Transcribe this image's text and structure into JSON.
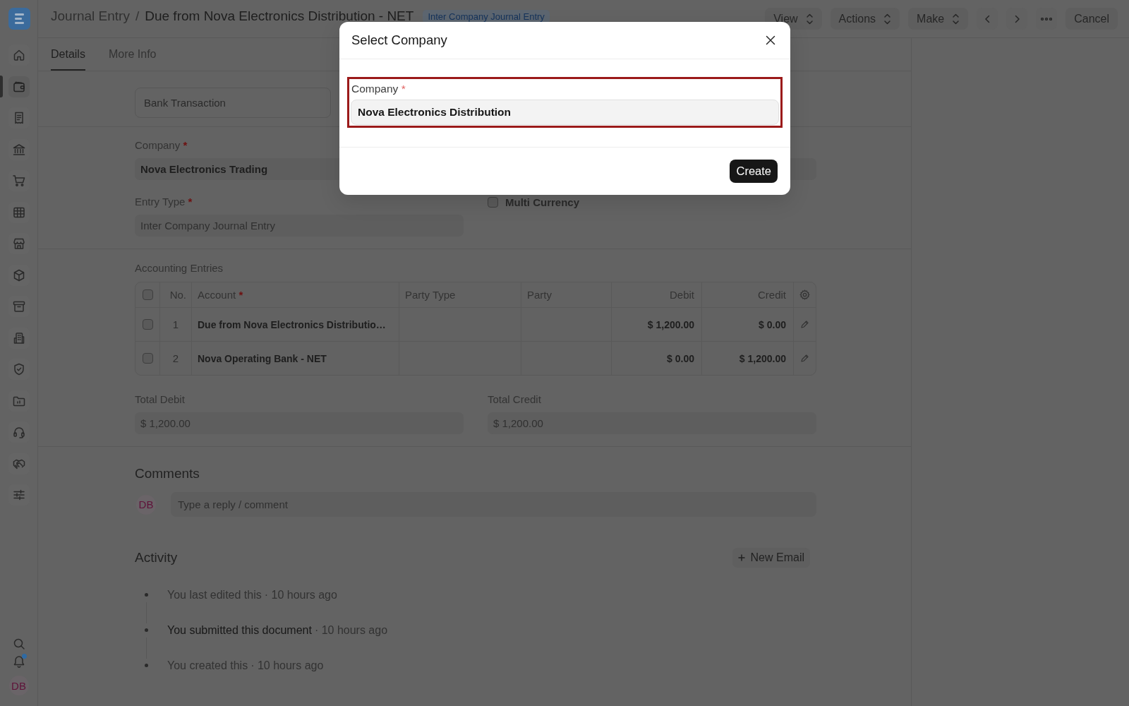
{
  "sidebar": {
    "items": [
      {
        "selected": false
      },
      {
        "selected": true
      },
      {
        "selected": false
      },
      {
        "selected": false
      },
      {
        "selected": false
      },
      {
        "selected": false
      },
      {
        "selected": false
      },
      {
        "selected": false
      },
      {
        "selected": false
      },
      {
        "selected": false
      },
      {
        "selected": false
      },
      {
        "selected": false
      },
      {
        "selected": false
      },
      {
        "selected": false
      },
      {
        "selected": false
      }
    ],
    "notification_dot": true,
    "user_initials": "DB"
  },
  "header": {
    "breadcrumb": "Journal Entry",
    "separator": "/",
    "title": "Due from Nova Electronics Distribution - NET",
    "badge": "Inter Company Journal Entry",
    "buttons": [
      {
        "kind": "menu",
        "label": "View"
      },
      {
        "kind": "menu",
        "label": "Actions"
      },
      {
        "kind": "menu",
        "label": "Make"
      },
      {
        "kind": "previous"
      },
      {
        "kind": "next"
      },
      {
        "kind": "more"
      },
      {
        "kind": "plain",
        "label": "Cancel"
      }
    ]
  },
  "tabs": [
    {
      "label": "Details",
      "selected": true
    },
    {
      "label": "More Info",
      "selected": false
    }
  ],
  "form": {
    "bank_transaction": {
      "value": "Bank Transaction"
    },
    "company": {
      "label": "Company",
      "required_mark": "*",
      "value": "Nova Electronics Trading"
    },
    "entry_type": {
      "label": "Entry Type",
      "required_mark": "*",
      "value": "Inter Company Journal Entry",
      "read_only": true
    },
    "multi_currency": {
      "label": "Multi Currency",
      "checked": false
    }
  },
  "accounting_entries": {
    "title": "Accounting Entries",
    "select_all_checked": false,
    "columns": [
      {
        "label": "No."
      },
      {
        "label": "Account",
        "required_mark": "*"
      },
      {
        "label": "Party Type"
      },
      {
        "label": "Party"
      },
      {
        "label": "Debit"
      },
      {
        "label": "Credit"
      }
    ],
    "rows": [
      {
        "checked": false,
        "no": "1",
        "account": "Due from Nova Electronics Distributio…",
        "debit": "$ 1,200.00",
        "credit": "$ 0.00"
      },
      {
        "checked": false,
        "no": "2",
        "account": "Nova Operating Bank - NET",
        "debit": "$ 0.00",
        "credit": "$ 1,200.00"
      }
    ]
  },
  "totals": [
    {
      "label": "Total Debit",
      "value": "$ 1,200.00"
    },
    {
      "label": "Total Credit",
      "value": "$ 1,200.00"
    }
  ],
  "comments": {
    "title": "Comments",
    "avatar_initials": "DB",
    "placeholder": "Type a reply / comment"
  },
  "activity": {
    "title": "Activity",
    "new_email": "New Email",
    "items": [
      {
        "text": "You last edited this",
        "time": "· 10 hours ago",
        "emphasis": false
      },
      {
        "text": "You submitted this document",
        "time": "· 10 hours ago",
        "emphasis": true
      },
      {
        "text": "You created this",
        "time": "· 10 hours ago",
        "emphasis": false
      }
    ]
  },
  "modal": {
    "title": "Select Company",
    "field": {
      "label": "Company",
      "required_mark": "*",
      "value": "Nova Electronics Distribution",
      "highlighted": true
    },
    "primary_button": "Create"
  }
}
